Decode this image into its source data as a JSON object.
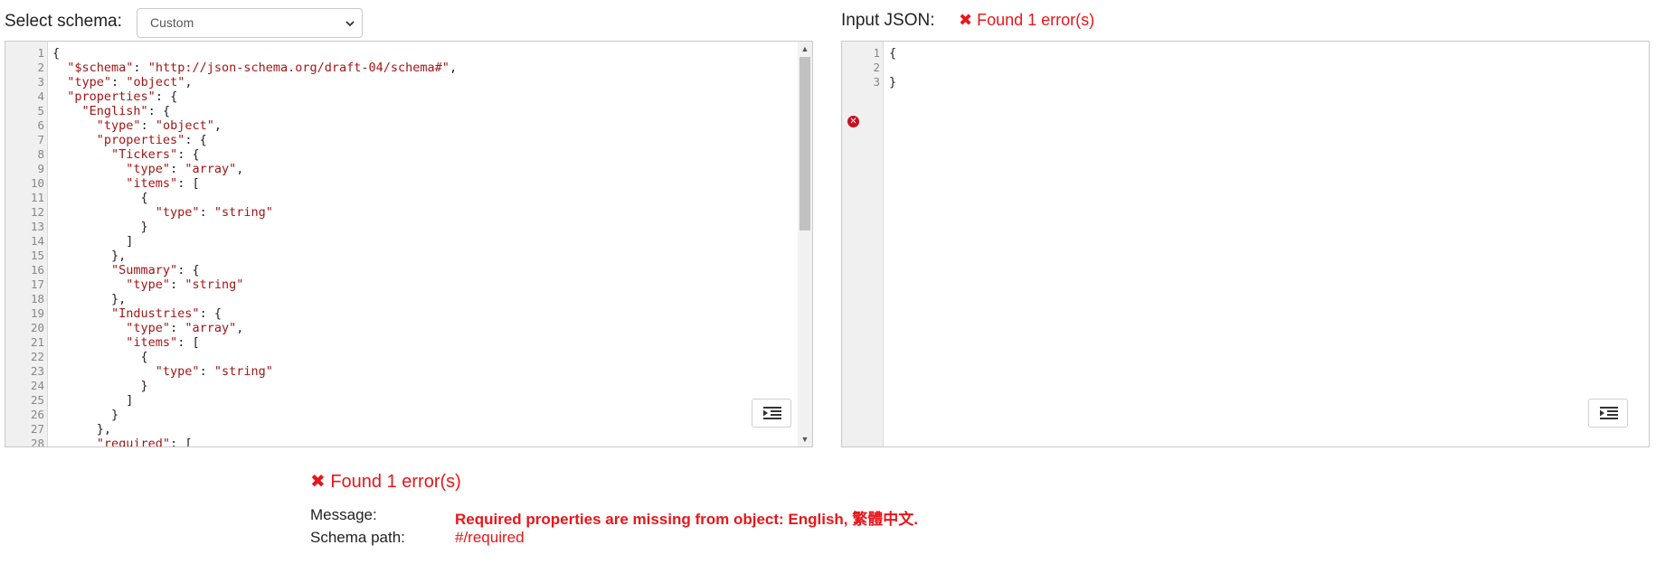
{
  "schema_selector": {
    "label": "Select schema:",
    "selected": "Custom"
  },
  "input": {
    "label": "Input JSON:",
    "error_summary": "Found 1 error(s)"
  },
  "schema_editor": {
    "line_numbers": [
      "1",
      "2",
      "3",
      "4",
      "5",
      "6",
      "7",
      "8",
      "9",
      "10",
      "11",
      "12",
      "13",
      "14",
      "15",
      "16",
      "17",
      "18",
      "19",
      "20",
      "21",
      "22",
      "23",
      "24",
      "25",
      "26",
      "27",
      "28"
    ],
    "lines": [
      "{",
      "  \"$schema\": \"http://json-schema.org/draft-04/schema#\",",
      "  \"type\": \"object\",",
      "  \"properties\": {",
      "    \"English\": {",
      "      \"type\": \"object\",",
      "      \"properties\": {",
      "        \"Tickers\": {",
      "          \"type\": \"array\",",
      "          \"items\": [",
      "            {",
      "              \"type\": \"string\"",
      "            }",
      "          ]",
      "        },",
      "        \"Summary\": {",
      "          \"type\": \"string\"",
      "        },",
      "        \"Industries\": {",
      "          \"type\": \"array\",",
      "          \"items\": [",
      "            {",
      "              \"type\": \"string\"",
      "            }",
      "          ]",
      "        }",
      "      },",
      "      \"required\": ["
    ]
  },
  "json_editor": {
    "line_numbers": [
      "1",
      "2",
      "3"
    ],
    "lines": [
      "{",
      "",
      "}"
    ],
    "error_line": "3"
  },
  "validation": {
    "error_summary": "Found 1 error(s)",
    "message_label": "Message:",
    "message_value": "Required properties are missing from object: English, 繁體中文.",
    "path_label": "Schema path:",
    "path_value": "#/required"
  },
  "colors": {
    "error": "#e8161a",
    "string": "#a31515"
  },
  "icons": {
    "error_x": "✖",
    "format_button": "format-indent-icon",
    "select_chevron": "chevron-down-icon"
  }
}
